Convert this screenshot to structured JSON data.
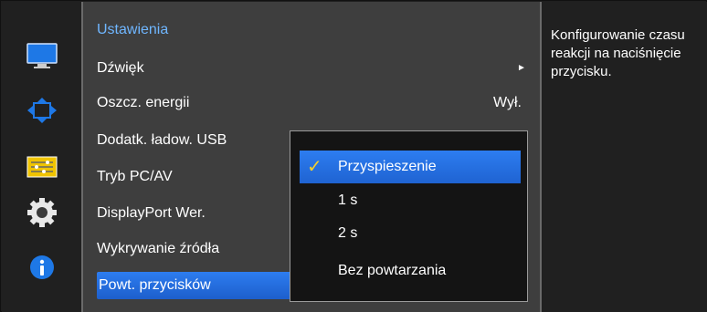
{
  "rail": {
    "icons": [
      "monitor-icon",
      "resize-arrows-icon",
      "settings-sliders-icon",
      "gear-icon",
      "info-icon"
    ]
  },
  "menu": {
    "title": "Ustawienia",
    "items": [
      {
        "label": "Dźwięk",
        "value": "",
        "has_arrow": true
      },
      {
        "label": "Oszcz. energii",
        "value": "Wył."
      },
      {
        "label": "Dodatk. ładow. USB",
        "value": ""
      },
      {
        "label": "Tryb PC/AV",
        "value": ""
      },
      {
        "label": "DisplayPort Wer.",
        "value": ""
      },
      {
        "label": "Wykrywanie źródła",
        "value": ""
      },
      {
        "label": "Powt. przycisków",
        "value": "",
        "selected": true
      }
    ],
    "arrow_glyph": "►"
  },
  "submenu": {
    "options": [
      {
        "label": "Przyspieszenie",
        "checked": true
      },
      {
        "label": "1 s"
      },
      {
        "label": "2 s"
      },
      {
        "label": "Bez powtarzania"
      }
    ],
    "check_glyph": "✓"
  },
  "help": {
    "text": "Konfigurowanie czasu reakcji na naciśnięcie przycisku."
  },
  "colors": {
    "accent": "#2d7df0",
    "title": "#6fb6ff",
    "check": "#f4d02c"
  }
}
